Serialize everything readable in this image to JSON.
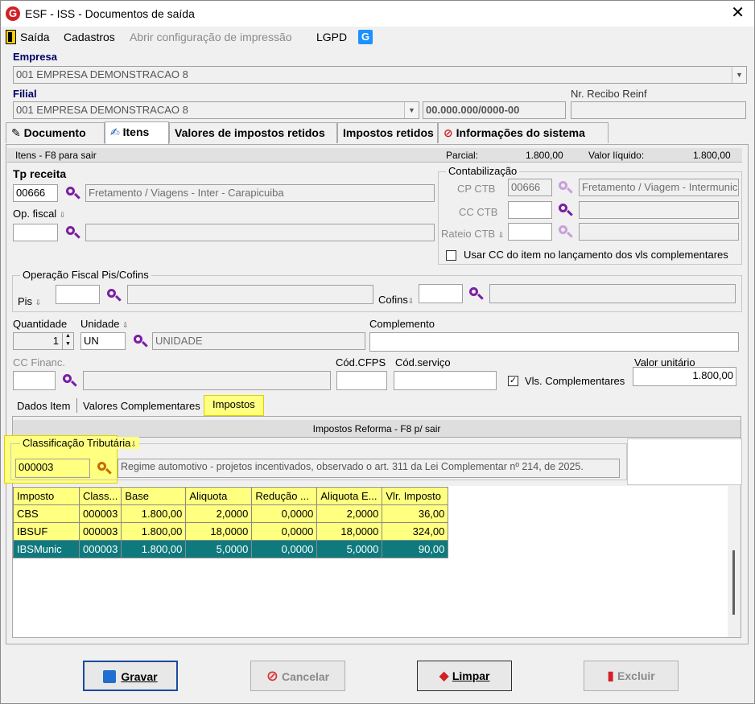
{
  "window": {
    "title": "ESF - ISS - Documentos de saída",
    "app_icon": "G",
    "close": "✕"
  },
  "menu": {
    "saida": "Saída",
    "cadastros": "Cadastros",
    "abrir": "Abrir configuração de impressão",
    "lgpd": "LGPD",
    "help_icon": "G"
  },
  "empresa": {
    "label": "Empresa",
    "value": "001 EMPRESA DEMONSTRACAO 8"
  },
  "filial": {
    "label": "Filial",
    "value": "001 EMPRESA DEMONSTRACAO 8",
    "cnpj": "00.000.000/0000-00",
    "recibo_label": "Nr. Recibo Reinf",
    "recibo_value": ""
  },
  "tabs": [
    "Documento",
    "Itens",
    "Valores de impostos retidos",
    "Impostos retidos",
    "Informações do sistema"
  ],
  "itens_header": {
    "title": "Itens - F8 para sair",
    "parcial_label": "Parcial:",
    "parcial_value": "1.800,00",
    "liquido_label": "Valor líquido:",
    "liquido_value": "1.800,00"
  },
  "tp_receita": {
    "label": "Tp receita",
    "code": "00666",
    "desc": "Fretamento / Viagens - Inter - Carapicuiba"
  },
  "op_fiscal": {
    "label": "Op. fiscal",
    "code": "",
    "desc": ""
  },
  "contabilizacao": {
    "title": "Contabilização",
    "cp_label": "CP CTB",
    "cp_code": "00666",
    "cp_desc": "Fretamento / Viagem - Intermunic",
    "cc_label": "CC CTB",
    "rateio_label": "Rateio CTB",
    "usar_cc": "Usar CC do item no lançamento dos vls complementares"
  },
  "pis_cofins": {
    "title": "Operação Fiscal Pis/Cofins",
    "pis_label": "Pis",
    "cofins_label": "Cofins"
  },
  "quantidade": {
    "label": "Quantidade",
    "value": "1",
    "unidade_label": "Unidade",
    "unidade_code": "UN",
    "unidade_desc": "UNIDADE",
    "complemento_label": "Complemento",
    "complemento_value": ""
  },
  "cc_financ": {
    "label": "CC Financ.",
    "cfps_label": "Cód.CFPS",
    "servico_label": "Cód.serviço",
    "vls_label": "Vls. Complementares",
    "valor_label": "Valor unitário",
    "valor_value": "1.800,00"
  },
  "subtabs": [
    "Dados Item",
    "Valores Complementares",
    "Impostos"
  ],
  "impostos": {
    "header": "Impostos Reforma - F8 p/ sair",
    "class_title": "Classificação Tributária",
    "class_code": "000003",
    "class_desc": "Regime automotivo - projetos incentivados, observado o art. 311 da Lei Complementar nº 214, de 2025."
  },
  "grid": {
    "columns": [
      "Imposto",
      "Class...",
      "Base",
      "Aliquota",
      "Redução ...",
      "Aliquota E...",
      "Vlr. Imposto"
    ],
    "rows": [
      [
        "CBS",
        "000003",
        "1.800,00",
        "2,0000",
        "0,0000",
        "2,0000",
        "36,00"
      ],
      [
        "IBSUF",
        "000003",
        "1.800,00",
        "18,0000",
        "0,0000",
        "18,0000",
        "324,00"
      ],
      [
        "IBSMunic",
        "000003",
        "1.800,00",
        "5,0000",
        "0,0000",
        "5,0000",
        "90,00"
      ]
    ]
  },
  "buttons": {
    "gravar": "Gravar",
    "cancelar": "Cancelar",
    "limpar": "Limpar",
    "excluir": "Excluir"
  },
  "colors": {
    "selected_row": "#0f7a7e",
    "highlight": "#ffff80",
    "label_blue": "#000066"
  }
}
